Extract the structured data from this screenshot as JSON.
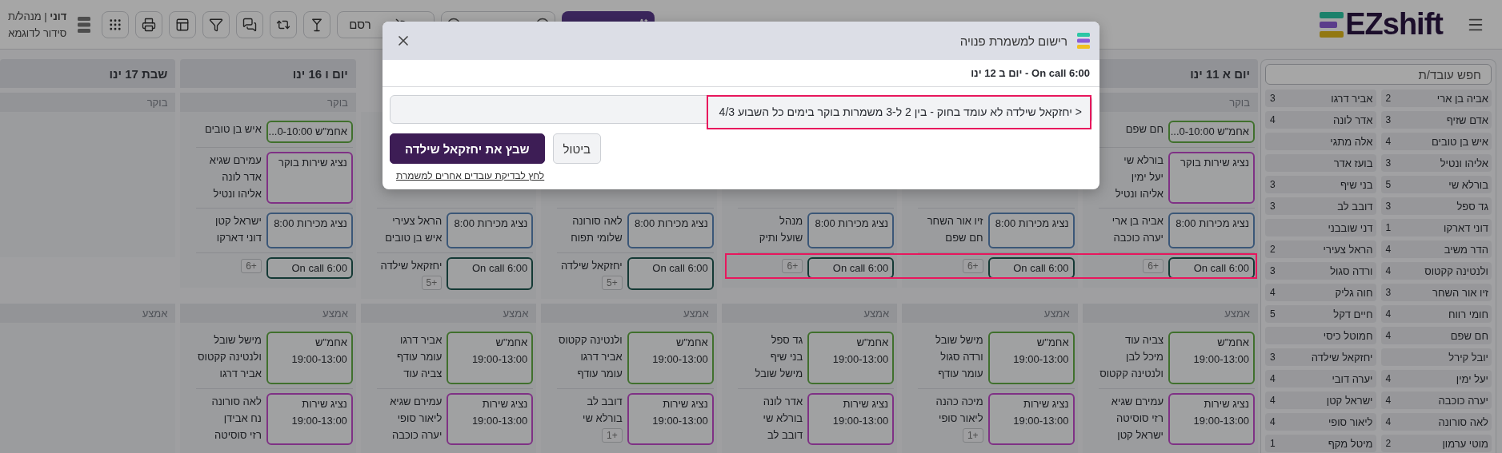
{
  "topbar": {
    "logo": "EZshift",
    "user": "**דוני** | מנהל/ת",
    "schedule": "סידור לדוגמא",
    "publish": "רסם"
  },
  "days": [
    {
      "header": "יום א 11 ינו",
      "sections": [
        {
          "kind": "morning",
          "label": "בוקר",
          "shifts": [
            {
              "kind": "manager",
              "title": "אחמ\"ש 0-10:00...",
              "names": [
                "חם שפם"
              ]
            },
            {
              "kind": "service",
              "title": "נציג שירות בוקר",
              "names": [
                "בורלא שי",
                "יעל ימין",
                "אליהו ונטיל"
              ]
            },
            {
              "kind": "sales",
              "title": "נציג מכירות 8:00",
              "names": [
                "אביה בן ארי",
                "יערה כוכבה"
              ]
            },
            {
              "kind": "oncall",
              "title": "On call 6:00",
              "more": "+6"
            }
          ]
        },
        {
          "kind": "middle",
          "label": "אמצע",
          "shifts": [
            {
              "kind": "manager",
              "title": "אחמ\"ש",
              "time": "19:00-13:00",
              "names": [
                "צביה עוד",
                "מיכל לבן",
                "ולנטינה קקטוס"
              ]
            },
            {
              "kind": "service",
              "title": "נציג שירות",
              "time": "19:00-13:00",
              "names": [
                "עמירם שגיא",
                "רזי סוסיטה",
                "ישראל קטן"
              ]
            }
          ]
        }
      ]
    },
    {
      "sections": [
        {
          "kind": "morning",
          "shifts": [
            {
              "kind": "sales",
              "title": "נציג מכירות 8:00",
              "names": [
                "זיו אור השחר",
                "חם שפם"
              ]
            },
            {
              "kind": "oncall",
              "title": "On call 6:00",
              "more": "+6"
            }
          ]
        },
        {
          "kind": "middle",
          "label": "אמצע",
          "shifts": [
            {
              "kind": "manager",
              "title": "אחמ\"ש",
              "time": "19:00-13:00",
              "names": [
                "מישל שובל",
                "ורדה סגול",
                "עומר עודף"
              ]
            },
            {
              "kind": "service",
              "title": "נציג שירות",
              "time": "19:00-13:00",
              "names": [
                "מיכה כהנה",
                "ליאור סופי"
              ],
              "more": "+1"
            }
          ]
        }
      ]
    },
    {
      "sections": [
        {
          "kind": "morning",
          "shifts": [
            {
              "kind": "sales",
              "title": "נציג מכירות 8:00",
              "names": [
                "מנהל",
                "שועל ותיק"
              ]
            },
            {
              "kind": "oncall",
              "title": "On call 6:00",
              "more": "+6"
            }
          ]
        },
        {
          "kind": "middle",
          "label": "אמצע",
          "shifts": [
            {
              "kind": "manager",
              "title": "אחמ\"ש",
              "time": "19:00-13:00",
              "names": [
                "גד ספל",
                "בני שיף",
                "מישל שובל"
              ]
            },
            {
              "kind": "service",
              "title": "נציג שירות",
              "time": "19:00-13:00",
              "names": [
                "אדר לונה",
                "בורלא שי",
                "דובב לב"
              ]
            }
          ]
        }
      ]
    },
    {
      "sections": [
        {
          "kind": "morning",
          "shifts": [
            {
              "kind": "sales",
              "title": "נציג מכירות 8:00",
              "names": [
                "לאה סורונה",
                "שלומי תפוח"
              ]
            },
            {
              "kind": "oncall",
              "title": "On call 6:00",
              "names": [
                "יחזקאל שילדה"
              ],
              "more": "+5"
            }
          ]
        },
        {
          "kind": "middle",
          "label": "אמצע",
          "shifts": [
            {
              "kind": "manager",
              "title": "אחמ\"ש",
              "time": "19:00-13:00",
              "names": [
                "ולנטינה קקטוס",
                "אביר דרגו",
                "עומר עודף"
              ]
            },
            {
              "kind": "service",
              "title": "נציג שירות",
              "time": "19:00-13:00",
              "names": [
                "דובב לב",
                "בורלא שי"
              ],
              "more": "+1"
            }
          ]
        }
      ]
    },
    {
      "sections": [
        {
          "kind": "morning",
          "shifts": [
            {
              "kind": "sales",
              "title": "נציג מכירות 8:00",
              "names": [
                "הראל צעירי",
                "איש בן טובים"
              ]
            },
            {
              "kind": "oncall",
              "title": "On call 6:00",
              "names": [
                "יחזקאל שילדה"
              ],
              "more": "+5"
            }
          ]
        },
        {
          "kind": "middle",
          "label": "אמצע",
          "shifts": [
            {
              "kind": "manager",
              "title": "אחמ\"ש",
              "time": "19:00-13:00",
              "names": [
                "אביר דרגו",
                "עומר עודף",
                "צביה עוד"
              ]
            },
            {
              "kind": "service",
              "title": "נציג שירות",
              "time": "19:00-13:00",
              "names": [
                "עמירם שגיא",
                "ליאור סופי",
                "יערה כוכבה"
              ]
            }
          ]
        }
      ]
    },
    {
      "header": "יום ו 16 ינו",
      "sections": [
        {
          "kind": "morning",
          "label": "בוקר",
          "shifts": [
            {
              "kind": "manager",
              "title": "אחמ\"ש 0-10:00...",
              "names": [
                "איש בן טובים"
              ]
            },
            {
              "kind": "service",
              "title": "נציג שירות בוקר",
              "names": [
                "עמירם שגיא",
                "אדר לונה",
                "אליהו ונטיל"
              ]
            },
            {
              "kind": "sales",
              "title": "נציג מכירות 8:00",
              "names": [
                "ישראל קטן",
                "דוני דארקו"
              ]
            },
            {
              "kind": "oncall",
              "title": "On call 6:00",
              "more": "+6"
            }
          ]
        },
        {
          "kind": "middle",
          "label": "אמצע",
          "shifts": [
            {
              "kind": "manager",
              "title": "אחמ\"ש",
              "time": "19:00-13:00",
              "names": [
                "מישל שובל",
                "ולנטינה קקטוס",
                "אביר דרגו"
              ]
            },
            {
              "kind": "service",
              "title": "נציג שירות",
              "time": "19:00-13:00",
              "names": [
                "לאה סורונה",
                "נח אבידן",
                "רזי סוסיטה"
              ]
            }
          ]
        }
      ]
    },
    {
      "header": "שבת 17 ינו",
      "sections": [
        {
          "kind": "morning",
          "label": "בוקר"
        },
        {
          "kind": "middle",
          "label": "אמצע"
        }
      ]
    }
  ],
  "sidebar": {
    "search_placeholder": "חפש עובד/ת",
    "employees": [
      {
        "name": "אביה בן ארי",
        "count": "2"
      },
      {
        "name": "אביר דרגו",
        "count": "3"
      },
      {
        "name": "אדם שזיף",
        "count": "3"
      },
      {
        "name": "אדר לונה",
        "count": "4"
      },
      {
        "name": "איש בן טובים",
        "count": "4"
      },
      {
        "name": "אלה מתגי"
      },
      {
        "name": "אליהו ונטיל",
        "count": "3"
      },
      {
        "name": "בועז אדר"
      },
      {
        "name": "בורלא שי",
        "count": "5"
      },
      {
        "name": "בני שיף",
        "count": "3"
      },
      {
        "name": "גד ספל",
        "count": "3"
      },
      {
        "name": "דובב לב",
        "count": "3"
      },
      {
        "name": "דוני דארקו",
        "count": "1"
      },
      {
        "name": "דני שובבני"
      },
      {
        "name": "הדר משיב",
        "count": "4"
      },
      {
        "name": "הראל צעירי",
        "count": "2"
      },
      {
        "name": "ולנטינה קקטוס",
        "count": "4"
      },
      {
        "name": "ורדה סגול",
        "count": "3"
      },
      {
        "name": "זיו אור השחר",
        "count": "3"
      },
      {
        "name": "חוה גליק",
        "count": "4"
      },
      {
        "name": "חומי רווח",
        "count": "4"
      },
      {
        "name": "חיים דקל",
        "count": "5"
      },
      {
        "name": "חם שפם",
        "count": "4"
      },
      {
        "name": "חמוטל כיסי"
      },
      {
        "name": "יובל קירל"
      },
      {
        "name": "יחזקאל שילדה",
        "count": "3"
      },
      {
        "name": "יעל ימין",
        "count": "4"
      },
      {
        "name": "יערה דובי",
        "count": "4"
      },
      {
        "name": "יערה כוכבה",
        "count": "4"
      },
      {
        "name": "ישראל קטן",
        "count": "4"
      },
      {
        "name": "לאה סורונה",
        "count": "4"
      },
      {
        "name": "ליאור סופי",
        "count": "4"
      },
      {
        "name": "מוטי ערמון",
        "count": "2"
      },
      {
        "name": "מיטל מקף",
        "count": "1"
      }
    ]
  },
  "modal": {
    "title": "רישום למשמרת פנויה",
    "subtitle": "On call 6:00 - יום ב 12 ינו",
    "message": "< יחזקאל שילדה לא עומד בחוק - בין 2 ל-3 משמרות בוקר בימים כל השבוע 4/3",
    "buttons": [
      {
        "kind": "secondary",
        "label": "ביטול"
      },
      {
        "kind": "primary",
        "label": "שבץ את יחזקאל שילדה"
      }
    ],
    "link": "לחץ לבדיקת עובדים אחרים למשמרת"
  }
}
